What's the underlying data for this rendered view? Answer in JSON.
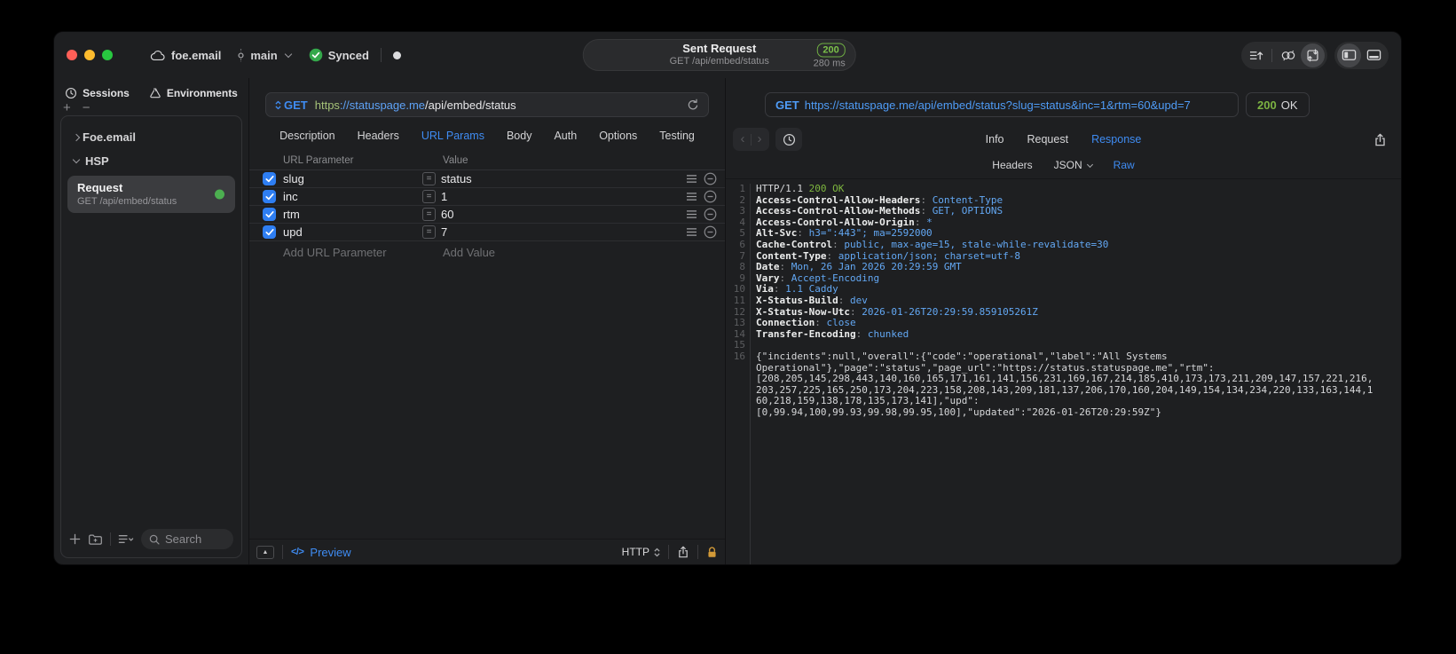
{
  "colors": {
    "accent_blue": "#3f8cf3",
    "url_blue": "#5ea2f6",
    "status_green": "#7cb342",
    "checkbox_blue": "#2e7ef2",
    "lock_gold": "#d29a38"
  },
  "titlebar": {
    "project": "foe.email",
    "branch": "main",
    "synced": "Synced",
    "summary": {
      "title": "Sent Request",
      "subtitle": "GET /api/embed/status",
      "status": "200",
      "duration": "280 ms"
    }
  },
  "sidebar": {
    "tabs": {
      "sessions": "Sessions",
      "environments": "Environments"
    },
    "tree": {
      "group1": "Foe.email",
      "group2": "HSP"
    },
    "request": {
      "title": "Request",
      "subtitle": "GET /api/embed/status"
    },
    "search_placeholder": "Search"
  },
  "request_editor": {
    "method": "GET",
    "url": {
      "scheme": "https",
      "host": "://statuspage.me",
      "path": "/api/embed/status"
    },
    "tabs": [
      {
        "label": "Description"
      },
      {
        "label": "Headers"
      },
      {
        "label": "URL Params",
        "active": true
      },
      {
        "label": "Body"
      },
      {
        "label": "Auth"
      },
      {
        "label": "Options"
      },
      {
        "label": "Testing"
      }
    ],
    "table": {
      "col_param": "URL Parameter",
      "col_value": "Value",
      "rows": [
        {
          "name": "slug",
          "value": "status",
          "checked": true
        },
        {
          "name": "inc",
          "value": "1",
          "checked": true
        },
        {
          "name": "rtm",
          "value": "60",
          "checked": true
        },
        {
          "name": "upd",
          "value": "7",
          "checked": true
        }
      ],
      "add_param": "Add URL Parameter",
      "add_value": "Add Value"
    },
    "footer": {
      "code_glyph": "</>",
      "preview": "Preview",
      "protocol": "HTTP"
    }
  },
  "response_viewer": {
    "request_line": {
      "method": "GET",
      "url": "https://statuspage.me/api/embed/status?slug=status&inc=1&rtm=60&upd=7"
    },
    "status": {
      "code": "200",
      "text": "OK"
    },
    "tabs": [
      {
        "label": "Info"
      },
      {
        "label": "Request"
      },
      {
        "label": "Response",
        "active": true
      }
    ],
    "subtabs": [
      {
        "label": "Headers"
      },
      {
        "label": "JSON",
        "chevron": true
      },
      {
        "label": "Raw",
        "active": true
      }
    ],
    "lines": [
      {
        "n": "1",
        "segs": [
          [
            "p",
            "HTTP/1.1 "
          ],
          [
            "g",
            "200 OK"
          ]
        ]
      },
      {
        "n": "2",
        "segs": [
          [
            "n",
            "Access-Control-Allow-Headers"
          ],
          [
            "d",
            ": "
          ],
          [
            "v",
            "Content-Type"
          ]
        ]
      },
      {
        "n": "3",
        "segs": [
          [
            "n",
            "Access-Control-Allow-Methods"
          ],
          [
            "d",
            ": "
          ],
          [
            "v",
            "GET, OPTIONS"
          ]
        ]
      },
      {
        "n": "4",
        "segs": [
          [
            "n",
            "Access-Control-Allow-Origin"
          ],
          [
            "d",
            ": "
          ],
          [
            "v",
            "*"
          ]
        ]
      },
      {
        "n": "5",
        "segs": [
          [
            "n",
            "Alt-Svc"
          ],
          [
            "d",
            ": "
          ],
          [
            "v",
            "h3=\":443\"; ma=2592000"
          ]
        ]
      },
      {
        "n": "6",
        "segs": [
          [
            "n",
            "Cache-Control"
          ],
          [
            "d",
            ": "
          ],
          [
            "v",
            "public, max-age=15, stale-while-revalidate=30"
          ]
        ]
      },
      {
        "n": "7",
        "segs": [
          [
            "n",
            "Content-Type"
          ],
          [
            "d",
            ": "
          ],
          [
            "v",
            "application/json; charset=utf-8"
          ]
        ]
      },
      {
        "n": "8",
        "segs": [
          [
            "n",
            "Date"
          ],
          [
            "d",
            ": "
          ],
          [
            "v",
            "Mon, 26 Jan 2026 20:29:59 GMT"
          ]
        ]
      },
      {
        "n": "9",
        "segs": [
          [
            "n",
            "Vary"
          ],
          [
            "d",
            ": "
          ],
          [
            "v",
            "Accept-Encoding"
          ]
        ]
      },
      {
        "n": "10",
        "segs": [
          [
            "n",
            "Via"
          ],
          [
            "d",
            ": "
          ],
          [
            "v",
            "1.1 Caddy"
          ]
        ]
      },
      {
        "n": "11",
        "segs": [
          [
            "n",
            "X-Status-Build"
          ],
          [
            "d",
            ": "
          ],
          [
            "v",
            "dev"
          ]
        ]
      },
      {
        "n": "12",
        "segs": [
          [
            "n",
            "X-Status-Now-Utc"
          ],
          [
            "d",
            ": "
          ],
          [
            "v",
            "2026-01-26T20:29:59.859105261Z"
          ]
        ]
      },
      {
        "n": "13",
        "segs": [
          [
            "n",
            "Connection"
          ],
          [
            "d",
            ": "
          ],
          [
            "v",
            "close"
          ]
        ]
      },
      {
        "n": "14",
        "segs": [
          [
            "n",
            "Transfer-Encoding"
          ],
          [
            "d",
            ": "
          ],
          [
            "v",
            "chunked"
          ]
        ]
      },
      {
        "n": "15",
        "segs": []
      },
      {
        "n": "16",
        "segs": [
          [
            "p",
            "{\"incidents\":null,\"overall\":{\"code\":\"operational\",\"label\":\"All Systems"
          ]
        ]
      },
      {
        "n": "",
        "segs": [
          [
            "p",
            "Operational\"},\"page\":\"status\",\"page_url\":\"https://status.statuspage.me\",\"rtm\":"
          ]
        ]
      },
      {
        "n": "",
        "segs": [
          [
            "p",
            "[208,205,145,298,443,140,160,165,171,161,141,156,231,169,167,214,185,410,173,173,211,209,147,157,221,216,"
          ]
        ]
      },
      {
        "n": "",
        "segs": [
          [
            "p",
            "203,257,225,165,250,173,204,223,158,208,143,209,181,137,206,170,160,204,149,154,134,234,220,133,163,144,1"
          ]
        ]
      },
      {
        "n": "",
        "segs": [
          [
            "p",
            "60,218,159,138,178,135,173,141],\"upd\":"
          ]
        ]
      },
      {
        "n": "",
        "segs": [
          [
            "p",
            "[0,99.94,100,99.93,99.98,99.95,100],\"updated\":\"2026-01-26T20:29:59Z\"}"
          ]
        ]
      }
    ]
  }
}
